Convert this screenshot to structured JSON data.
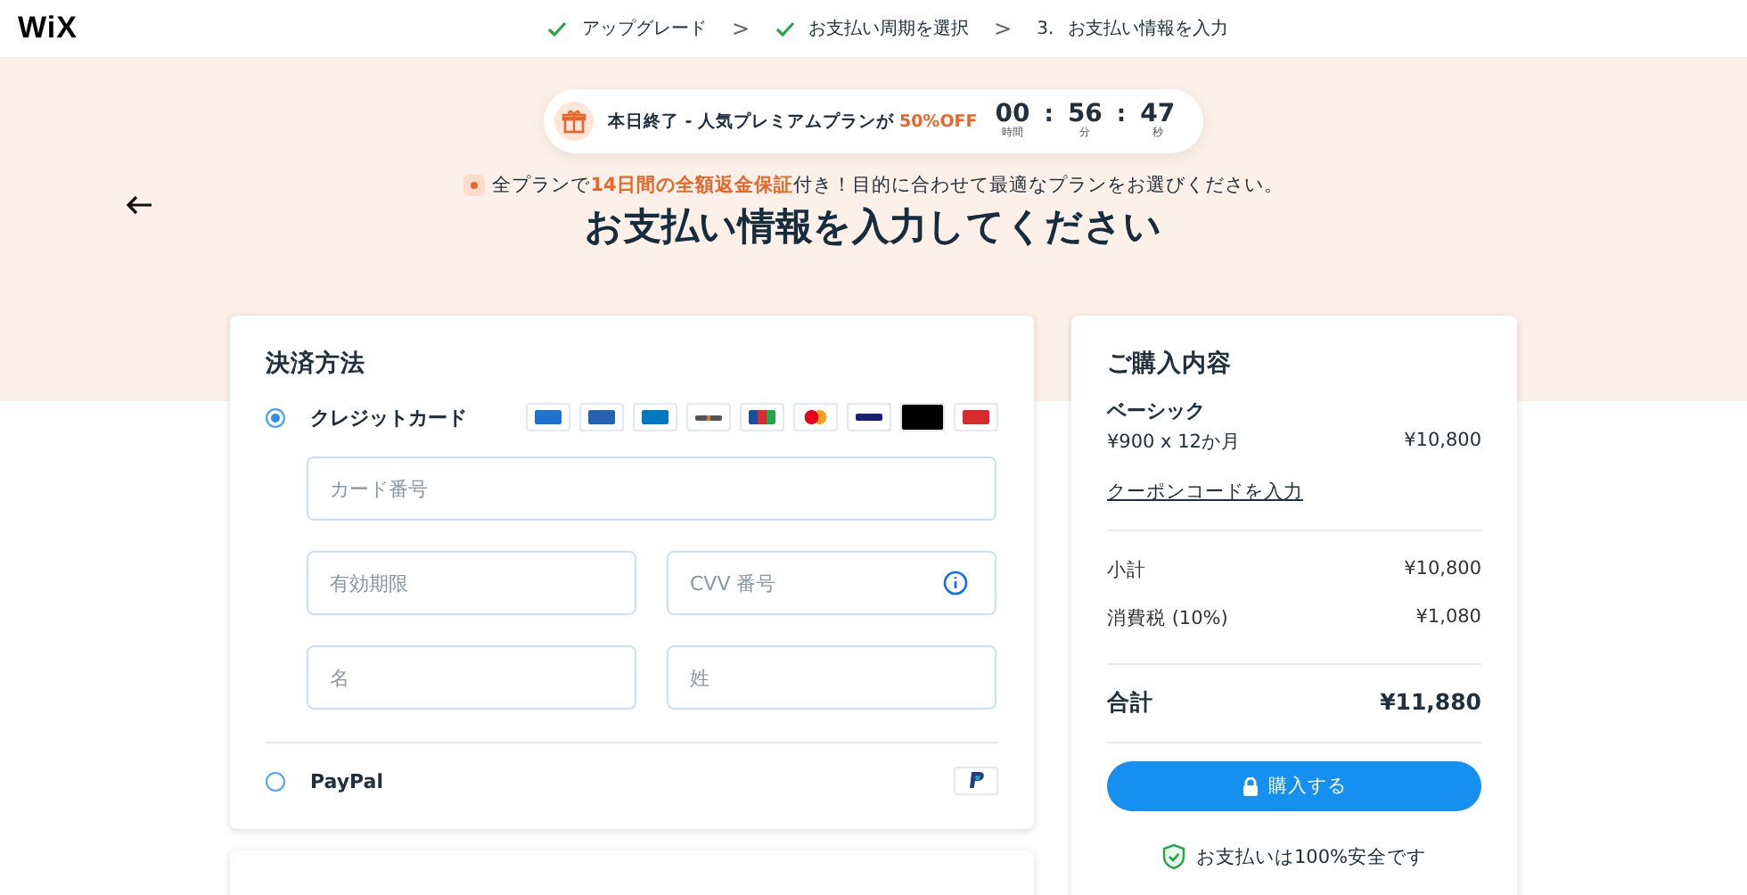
{
  "logo": "WiX",
  "steps": [
    {
      "kind": "done",
      "label": "アップグレード"
    },
    {
      "kind": "done",
      "label": "お支払い周期を選択"
    },
    {
      "kind": "current",
      "number": "3.",
      "label": "お支払い情報を入力"
    }
  ],
  "step_separator": ">",
  "promo": {
    "text": "本日終了 - 人気プレミアムプランが",
    "highlight": "50%OFF",
    "separator": ":",
    "countdown": [
      {
        "value": "00",
        "unit": "時間"
      },
      {
        "value": "56",
        "unit": "分"
      },
      {
        "value": "47",
        "unit": "秒"
      }
    ]
  },
  "guarantee": {
    "before": "全プランで",
    "highlight": "14日間の全額返金保証",
    "after": "付き！目的に合わせて最適なプランをお選びください。"
  },
  "title": "お支払い情報を入力してください",
  "payment": {
    "title": "決済方法",
    "methods": [
      {
        "kind": "card",
        "label": "クレジットカード",
        "selected": true
      },
      {
        "kind": "paypal",
        "label": "PayPal",
        "selected": false
      }
    ],
    "fields": [
      {
        "placeholder": "カード番号",
        "kind": "full",
        "info": false
      },
      {
        "placeholder": "有効期限",
        "kind": "half",
        "info": false
      },
      {
        "placeholder": "CVV 番号",
        "kind": "half",
        "info": true
      },
      {
        "placeholder": "名",
        "kind": "half",
        "info": false
      },
      {
        "placeholder": "姓",
        "kind": "half",
        "info": false
      }
    ]
  },
  "summary": {
    "title": "ご購入内容",
    "plan": "ベーシック",
    "plan_price": "¥900 x 12か月",
    "plan_total": "¥10,800",
    "coupon": "クーポンコードを入力",
    "lines": [
      {
        "label": "小計",
        "value": "¥10,800"
      },
      {
        "label": "消費税 (10%)",
        "value": "¥1,080"
      }
    ],
    "total_label": "合計",
    "total": "¥11,880",
    "button": "購入する",
    "secure": "お支払いは100%安全です"
  }
}
